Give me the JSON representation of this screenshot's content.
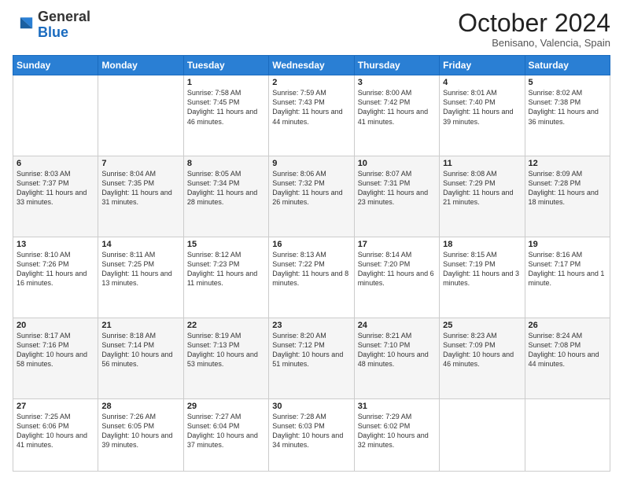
{
  "header": {
    "logo_general": "General",
    "logo_blue": "Blue",
    "month_title": "October 2024",
    "subtitle": "Benisano, Valencia, Spain"
  },
  "days_of_week": [
    "Sunday",
    "Monday",
    "Tuesday",
    "Wednesday",
    "Thursday",
    "Friday",
    "Saturday"
  ],
  "weeks": [
    [
      {
        "day": "",
        "content": ""
      },
      {
        "day": "",
        "content": ""
      },
      {
        "day": "1",
        "content": "Sunrise: 7:58 AM\nSunset: 7:45 PM\nDaylight: 11 hours and 46 minutes."
      },
      {
        "day": "2",
        "content": "Sunrise: 7:59 AM\nSunset: 7:43 PM\nDaylight: 11 hours and 44 minutes."
      },
      {
        "day": "3",
        "content": "Sunrise: 8:00 AM\nSunset: 7:42 PM\nDaylight: 11 hours and 41 minutes."
      },
      {
        "day": "4",
        "content": "Sunrise: 8:01 AM\nSunset: 7:40 PM\nDaylight: 11 hours and 39 minutes."
      },
      {
        "day": "5",
        "content": "Sunrise: 8:02 AM\nSunset: 7:38 PM\nDaylight: 11 hours and 36 minutes."
      }
    ],
    [
      {
        "day": "6",
        "content": "Sunrise: 8:03 AM\nSunset: 7:37 PM\nDaylight: 11 hours and 33 minutes."
      },
      {
        "day": "7",
        "content": "Sunrise: 8:04 AM\nSunset: 7:35 PM\nDaylight: 11 hours and 31 minutes."
      },
      {
        "day": "8",
        "content": "Sunrise: 8:05 AM\nSunset: 7:34 PM\nDaylight: 11 hours and 28 minutes."
      },
      {
        "day": "9",
        "content": "Sunrise: 8:06 AM\nSunset: 7:32 PM\nDaylight: 11 hours and 26 minutes."
      },
      {
        "day": "10",
        "content": "Sunrise: 8:07 AM\nSunset: 7:31 PM\nDaylight: 11 hours and 23 minutes."
      },
      {
        "day": "11",
        "content": "Sunrise: 8:08 AM\nSunset: 7:29 PM\nDaylight: 11 hours and 21 minutes."
      },
      {
        "day": "12",
        "content": "Sunrise: 8:09 AM\nSunset: 7:28 PM\nDaylight: 11 hours and 18 minutes."
      }
    ],
    [
      {
        "day": "13",
        "content": "Sunrise: 8:10 AM\nSunset: 7:26 PM\nDaylight: 11 hours and 16 minutes."
      },
      {
        "day": "14",
        "content": "Sunrise: 8:11 AM\nSunset: 7:25 PM\nDaylight: 11 hours and 13 minutes."
      },
      {
        "day": "15",
        "content": "Sunrise: 8:12 AM\nSunset: 7:23 PM\nDaylight: 11 hours and 11 minutes."
      },
      {
        "day": "16",
        "content": "Sunrise: 8:13 AM\nSunset: 7:22 PM\nDaylight: 11 hours and 8 minutes."
      },
      {
        "day": "17",
        "content": "Sunrise: 8:14 AM\nSunset: 7:20 PM\nDaylight: 11 hours and 6 minutes."
      },
      {
        "day": "18",
        "content": "Sunrise: 8:15 AM\nSunset: 7:19 PM\nDaylight: 11 hours and 3 minutes."
      },
      {
        "day": "19",
        "content": "Sunrise: 8:16 AM\nSunset: 7:17 PM\nDaylight: 11 hours and 1 minute."
      }
    ],
    [
      {
        "day": "20",
        "content": "Sunrise: 8:17 AM\nSunset: 7:16 PM\nDaylight: 10 hours and 58 minutes."
      },
      {
        "day": "21",
        "content": "Sunrise: 8:18 AM\nSunset: 7:14 PM\nDaylight: 10 hours and 56 minutes."
      },
      {
        "day": "22",
        "content": "Sunrise: 8:19 AM\nSunset: 7:13 PM\nDaylight: 10 hours and 53 minutes."
      },
      {
        "day": "23",
        "content": "Sunrise: 8:20 AM\nSunset: 7:12 PM\nDaylight: 10 hours and 51 minutes."
      },
      {
        "day": "24",
        "content": "Sunrise: 8:21 AM\nSunset: 7:10 PM\nDaylight: 10 hours and 48 minutes."
      },
      {
        "day": "25",
        "content": "Sunrise: 8:23 AM\nSunset: 7:09 PM\nDaylight: 10 hours and 46 minutes."
      },
      {
        "day": "26",
        "content": "Sunrise: 8:24 AM\nSunset: 7:08 PM\nDaylight: 10 hours and 44 minutes."
      }
    ],
    [
      {
        "day": "27",
        "content": "Sunrise: 7:25 AM\nSunset: 6:06 PM\nDaylight: 10 hours and 41 minutes."
      },
      {
        "day": "28",
        "content": "Sunrise: 7:26 AM\nSunset: 6:05 PM\nDaylight: 10 hours and 39 minutes."
      },
      {
        "day": "29",
        "content": "Sunrise: 7:27 AM\nSunset: 6:04 PM\nDaylight: 10 hours and 37 minutes."
      },
      {
        "day": "30",
        "content": "Sunrise: 7:28 AM\nSunset: 6:03 PM\nDaylight: 10 hours and 34 minutes."
      },
      {
        "day": "31",
        "content": "Sunrise: 7:29 AM\nSunset: 6:02 PM\nDaylight: 10 hours and 32 minutes."
      },
      {
        "day": "",
        "content": ""
      },
      {
        "day": "",
        "content": ""
      }
    ]
  ]
}
